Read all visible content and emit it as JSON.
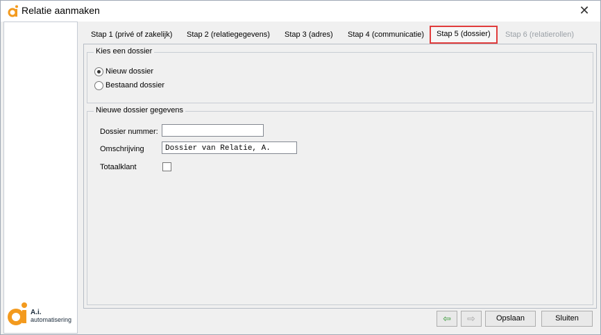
{
  "window": {
    "title": "Relatie aanmaken",
    "close_glyph": "✕"
  },
  "brand": {
    "name": "A.i.",
    "tagline": "automatisering",
    "logo_icon": "ai-logo-icon",
    "accent_color": "#f39a1e"
  },
  "tabs": [
    {
      "label": "Stap 1 (privé of zakelijk)",
      "state": "normal"
    },
    {
      "label": "Stap 2 (relatiegegevens)",
      "state": "normal"
    },
    {
      "label": "Stap 3 (adres)",
      "state": "normal"
    },
    {
      "label": "Stap 4 (communicatie)",
      "state": "normal"
    },
    {
      "label": "Stap 5 (dossier)",
      "state": "active",
      "highlight_color": "#e03b3b"
    },
    {
      "label": "Stap 6 (relatierollen)",
      "state": "disabled"
    }
  ],
  "choose_dossier": {
    "legend": "Kies een dossier",
    "options": [
      {
        "label": "Nieuw dossier",
        "checked": true
      },
      {
        "label": "Bestaand dossier",
        "checked": false
      }
    ]
  },
  "new_dossier": {
    "legend": "Nieuwe dossier gegevens",
    "number_label": "Dossier nummer:",
    "number_value": "",
    "description_label": "Omschrijving",
    "description_value": "Dossier van Relatie,  A.",
    "total_client_label": "Totaalklant",
    "total_client_checked": false
  },
  "footer": {
    "back_icon": "arrow-left-icon",
    "forward_icon": "arrow-right-icon",
    "save_label": "Opslaan",
    "close_label": "Sluiten"
  }
}
